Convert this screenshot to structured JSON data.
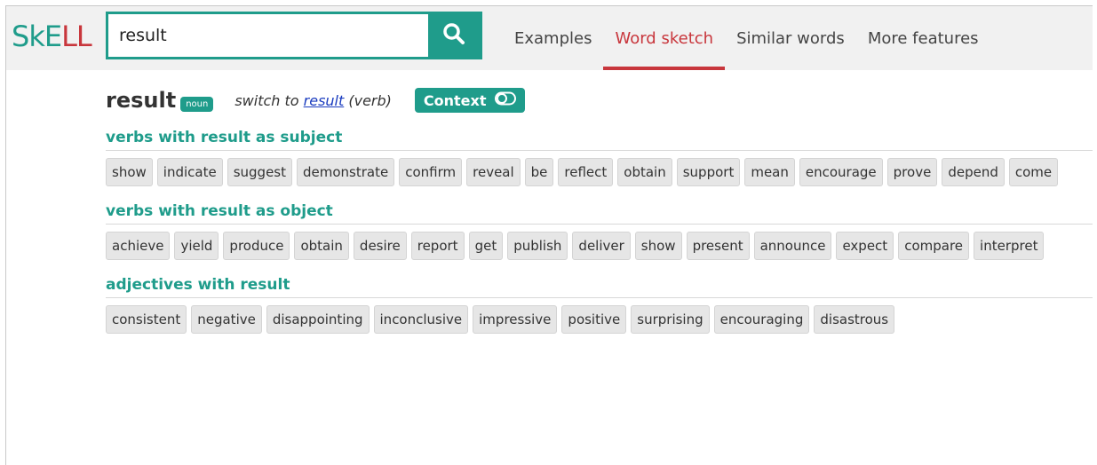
{
  "brand": {
    "logo_part1": "SkE",
    "logo_part2": "LL"
  },
  "colors": {
    "accent": "#1f9c8b",
    "active": "#c8363c",
    "chip_bg": "#e6e6e6"
  },
  "search": {
    "value": "result",
    "button_icon": "search-icon"
  },
  "nav": {
    "examples": "Examples",
    "word_sketch": "Word sketch",
    "similar_words": "Similar words",
    "more_features": "More features",
    "active": "Word sketch"
  },
  "headword": {
    "word": "result",
    "pos": "noun",
    "switch_prefix": "switch to ",
    "switch_link": "result",
    "switch_suffix": " (verb)",
    "context_label": "Context",
    "context_icon": "toggle-icon"
  },
  "sections": [
    {
      "title": "verbs with result as subject",
      "words": [
        "show",
        "indicate",
        "suggest",
        "demonstrate",
        "confirm",
        "reveal",
        "be",
        "reflect",
        "obtain",
        "support",
        "mean",
        "encourage",
        "prove",
        "depend",
        "come"
      ]
    },
    {
      "title": "verbs with result as object",
      "words": [
        "achieve",
        "yield",
        "produce",
        "obtain",
        "desire",
        "report",
        "get",
        "publish",
        "deliver",
        "show",
        "present",
        "announce",
        "expect",
        "compare",
        "interpret"
      ]
    },
    {
      "title": "adjectives with result",
      "words": [
        "consistent",
        "negative",
        "disappointing",
        "inconclusive",
        "impressive",
        "positive",
        "surprising",
        "encouraging",
        "disastrous"
      ]
    }
  ]
}
